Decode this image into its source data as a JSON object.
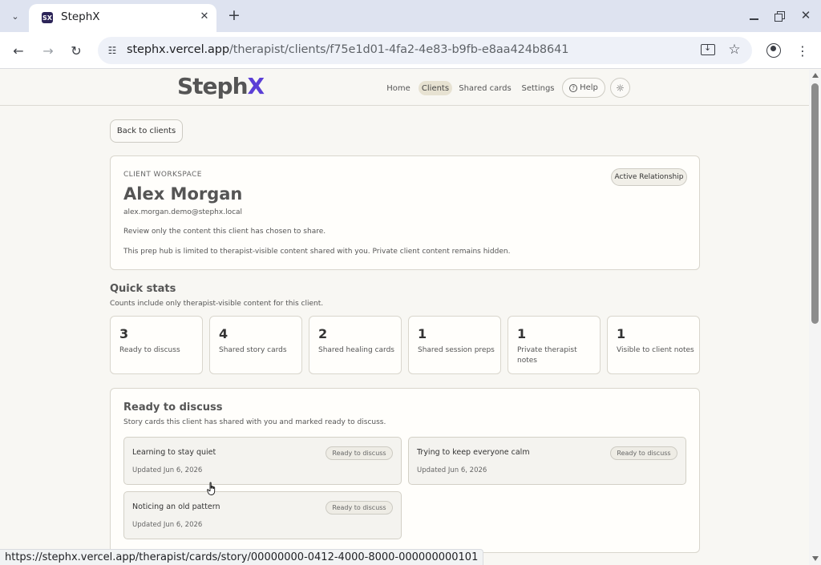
{
  "browser": {
    "tab_title": "StephX",
    "favicon_text": "SX",
    "url_host": "stephx.vercel.app",
    "url_path": "/therapist/clients/f75e1d01-4fa2-4e83-b9fb-e8aa424b8641",
    "status_url": "https://stephx.vercel.app/therapist/cards/story/00000000-0412-4000-8000-000000000101"
  },
  "header": {
    "logo_main": "Steph",
    "logo_accent": "X",
    "nav": {
      "home": "Home",
      "clients": "Clients",
      "shared_cards": "Shared cards",
      "settings": "Settings",
      "help": "Help"
    }
  },
  "back_button": "Back to clients",
  "workspace": {
    "eyebrow": "CLIENT WORKSPACE",
    "name": "Alex Morgan",
    "email": "alex.morgan.demo@stephx.local",
    "note1": "Review only the content this client has chosen to share.",
    "note2": "This prep hub is limited to therapist-visible content shared with you. Private client content remains hidden.",
    "status": "Active Relationship"
  },
  "quick_stats": {
    "title": "Quick stats",
    "subtitle": "Counts include only therapist-visible content for this client.",
    "items": [
      {
        "value": "3",
        "label": "Ready to discuss"
      },
      {
        "value": "4",
        "label": "Shared story cards"
      },
      {
        "value": "2",
        "label": "Shared healing cards"
      },
      {
        "value": "1",
        "label": "Shared session preps"
      },
      {
        "value": "1",
        "label": "Private therapist notes"
      },
      {
        "value": "1",
        "label": "Visible to client notes"
      }
    ]
  },
  "ready_to_discuss": {
    "title": "Ready to discuss",
    "subtitle": "Story cards this client has shared with you and marked ready to discuss.",
    "cards": [
      {
        "title": "Learning to stay quiet",
        "updated": "Updated Jun 6, 2026",
        "badge": "Ready to discuss"
      },
      {
        "title": "Trying to keep everyone calm",
        "updated": "Updated Jun 6, 2026",
        "badge": "Ready to discuss"
      },
      {
        "title": "Noticing an old pattern",
        "updated": "Updated Jun 6, 2026",
        "badge": "Ready to discuss"
      }
    ]
  }
}
